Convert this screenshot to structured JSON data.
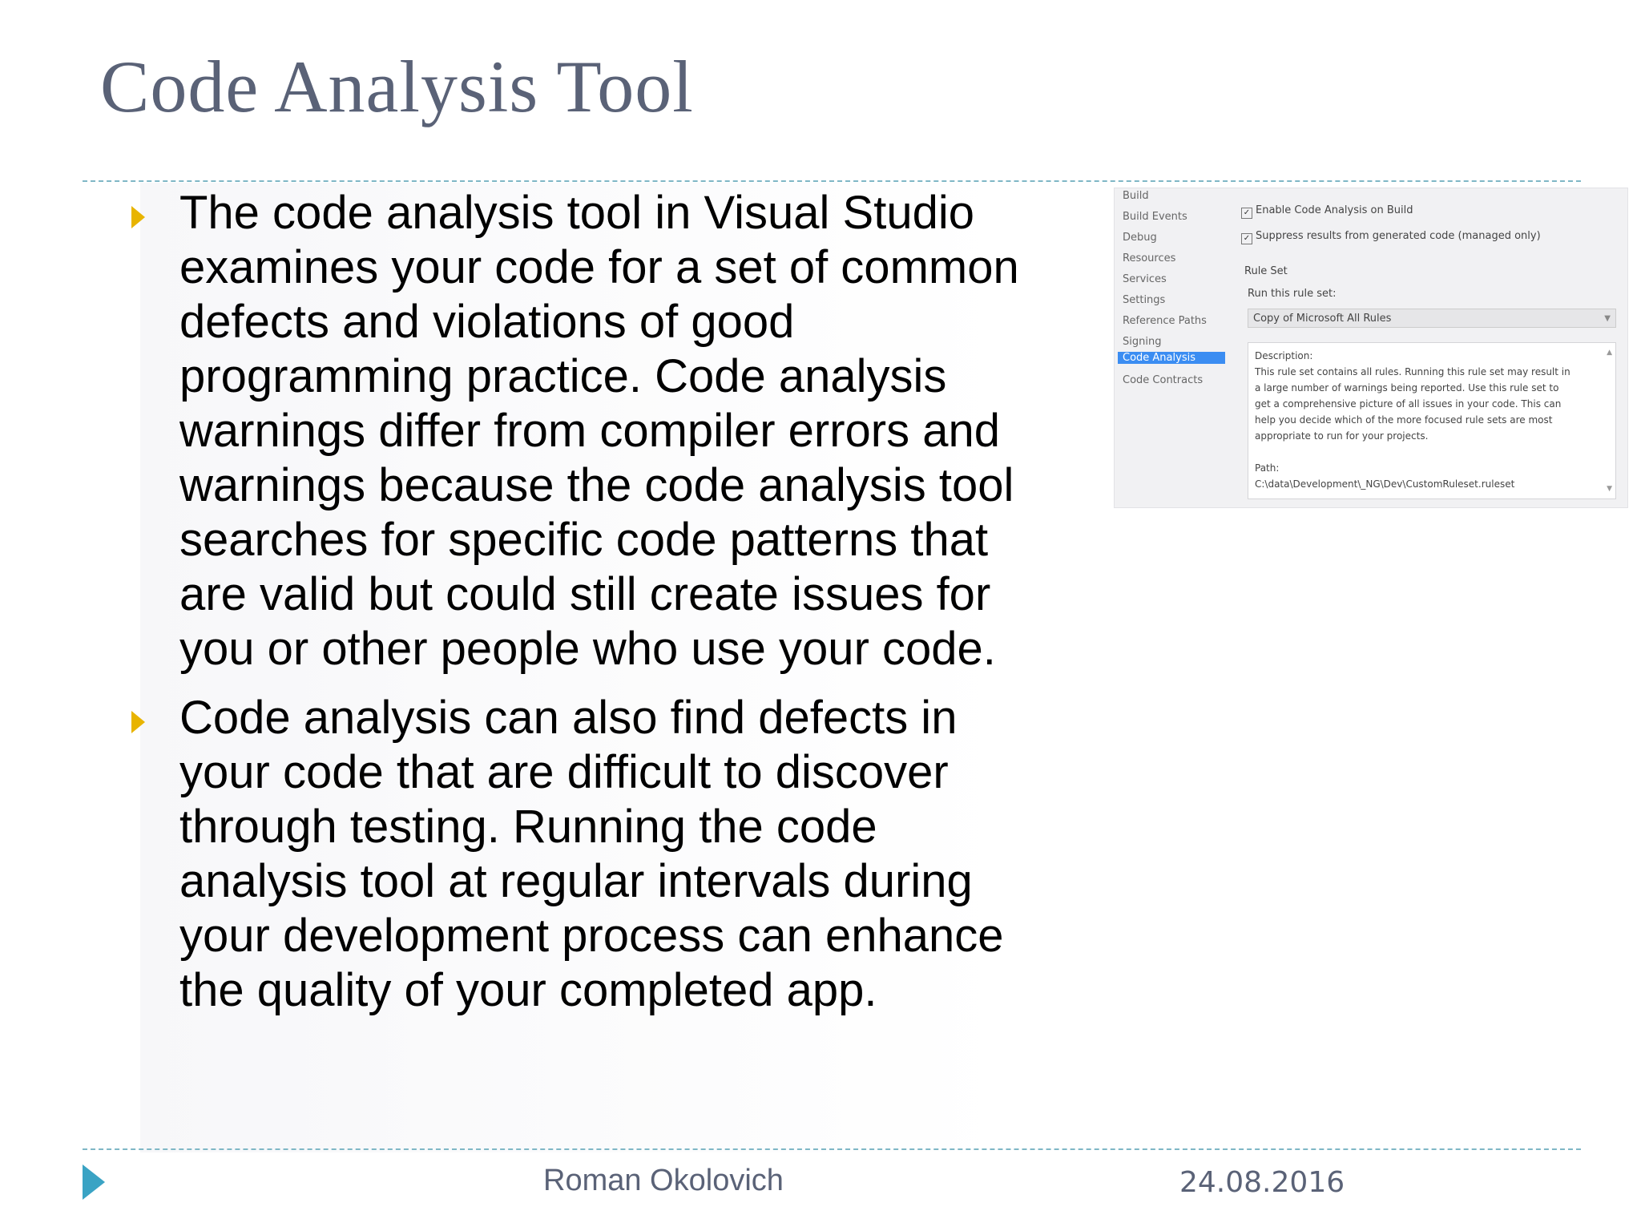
{
  "slide": {
    "title": "Code Analysis Tool",
    "bullets": [
      {
        "lines": [
          "The code analysis tool in Visual Studio",
          "examines your code for a set of common",
          "defects and violations of good",
          "programming practice. Code analysis",
          "warnings differ from compiler errors and",
          "warnings because the code analysis tool",
          "searches for specific code patterns that",
          "are valid but could still create issues for",
          "you or other people who use your code."
        ]
      },
      {
        "lines": [
          "Code analysis can also find defects in",
          "your code that are difficult to discover",
          "through testing. Running the code",
          "analysis tool at regular intervals during",
          "your development process can enhance",
          "the quality of your completed app."
        ]
      }
    ],
    "footer": {
      "author": "Roman Okolovich",
      "date": "24.08.2016"
    }
  },
  "screenshot": {
    "nav_items": [
      "Build",
      "Build Events",
      "Debug",
      "Resources",
      "Services",
      "Settings",
      "Reference Paths",
      "Signing",
      "Code Analysis",
      "Code Contracts"
    ],
    "selected_nav": "Code Analysis",
    "checkboxes": [
      {
        "label": "Enable Code Analysis on Build",
        "checked": true
      },
      {
        "label": "Suppress results from generated code (managed only)",
        "checked": true
      }
    ],
    "rule_set_heading": "Rule Set",
    "run_rule_set_label": "Run this rule set:",
    "selected_rule_set": "Copy of Microsoft All Rules",
    "description_label": "Description:",
    "description_lines": [
      "This rule set contains all rules. Running this rule set may result in",
      "a large number of warnings being reported. Use this rule set to",
      "get a comprehensive picture of all issues in your code. This can",
      "help you decide which of the more focused rule sets are most",
      "appropriate to run for your projects."
    ],
    "path_label": "Path:",
    "path_value": "C:\\data\\Development\\_NG\\Dev\\CustomRuleset.ruleset"
  },
  "colors": {
    "title": "#5a6277",
    "bullet_marker": "#e8b400",
    "rule": "#7fb7c6",
    "footer_arrow": "#3aa3c4",
    "selected_nav": "#3b8df2"
  }
}
